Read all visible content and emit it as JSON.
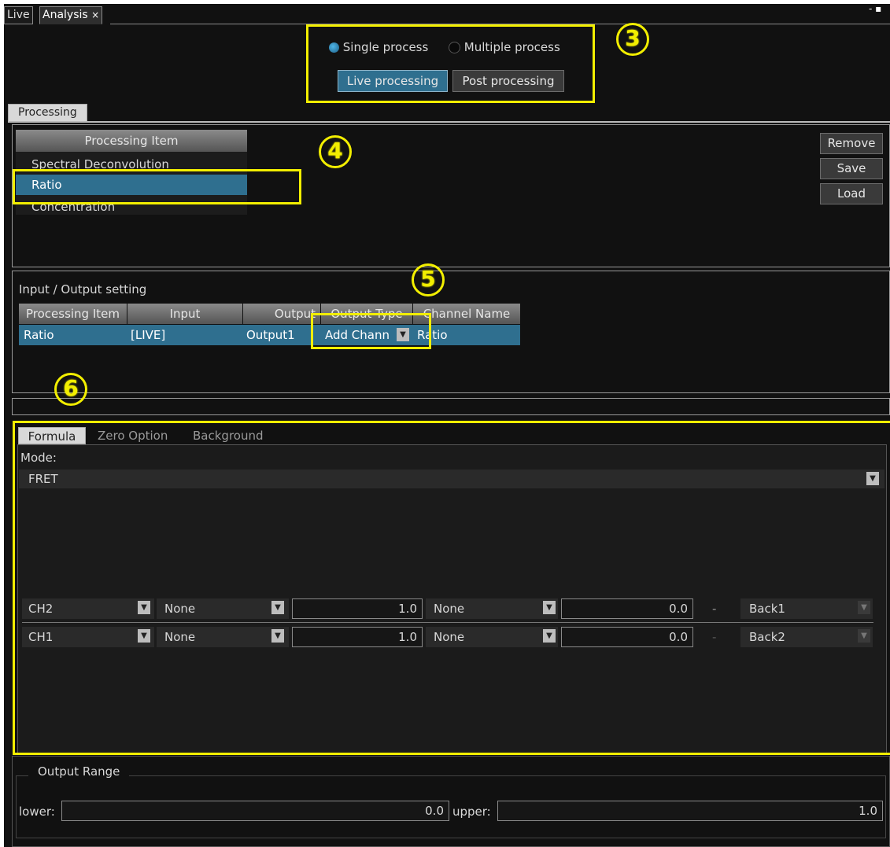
{
  "tabs": {
    "live": "Live",
    "analysis": "Analysis",
    "close_glyph": "×",
    "window_controls": "- ▪"
  },
  "mode_group": {
    "single_label": "Single process",
    "multiple_label": "Multiple process",
    "selected": "Single process",
    "live_btn": "Live processing",
    "post_btn": "Post processing"
  },
  "processing_tab": "Processing",
  "item_list": {
    "header": "Processing Item",
    "items": [
      "Spectral Deconvolution",
      "Ratio",
      "Concentration"
    ],
    "selected_index": 1
  },
  "side_buttons": {
    "remove": "Remove",
    "save": "Save",
    "load": "Load"
  },
  "io": {
    "title": "Input / Output setting",
    "columns": [
      "Processing Item",
      "Input",
      "Output",
      "Output Type",
      "Channel Name"
    ],
    "row": [
      "Ratio",
      "[LIVE]",
      "Output1",
      "Add Chann",
      "Ratio"
    ]
  },
  "subtabs": [
    "Formula",
    "Zero Option",
    "Background"
  ],
  "mode_label": "Mode:",
  "mode_value": "FRET",
  "formula_rows": [
    {
      "ch": "CH2",
      "op1": "None",
      "val1": "1.0",
      "op2": "None",
      "val2": "0.0",
      "minus": "-",
      "back": "Back1"
    },
    {
      "ch": "CH1",
      "op1": "None",
      "val1": "1.0",
      "op2": "None",
      "val2": "0.0",
      "minus": "-",
      "back": "Back2"
    }
  ],
  "output_range": {
    "title": "Output Range",
    "lower_label": "lower:",
    "lower": "0.0",
    "upper_label": "upper:",
    "upper": "1.0"
  },
  "annotations": {
    "n3": "3",
    "n4": "4",
    "n5": "5",
    "n6": "6"
  },
  "colors": {
    "accent_select": "#2f6f8f",
    "annotation": "#f2ee00",
    "background": "#111111"
  }
}
